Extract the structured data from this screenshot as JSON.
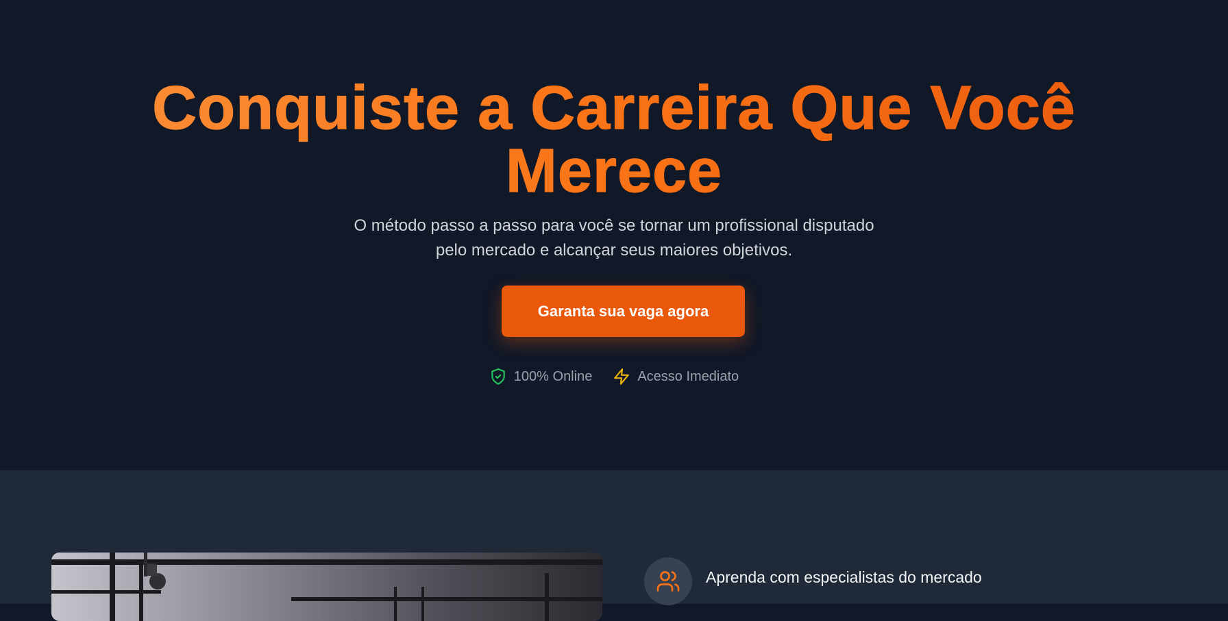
{
  "hero": {
    "title_line1": "Conquiste a Carreira Que Você",
    "title_line2": "Merece",
    "subtitle": "O método passo a passo para você se tornar um profissional disputado pelo mercado e alcançar seus maiores objetivos.",
    "cta_label": "Garanta sua vaga agora",
    "badges": [
      {
        "icon": "shield-check-icon",
        "label": "100% Online",
        "color": "#22c55e"
      },
      {
        "icon": "lightning-icon",
        "label": "Acesso Imediato",
        "color": "#eab308"
      }
    ]
  },
  "features": {
    "items": [
      {
        "icon": "users-icon",
        "label": "Aprenda com especialistas do mercado",
        "color": "#f97316"
      }
    ]
  },
  "colors": {
    "background": "#111827",
    "section_background": "#1f2937",
    "accent": "#ea580c",
    "accent_light": "#fb923c"
  }
}
